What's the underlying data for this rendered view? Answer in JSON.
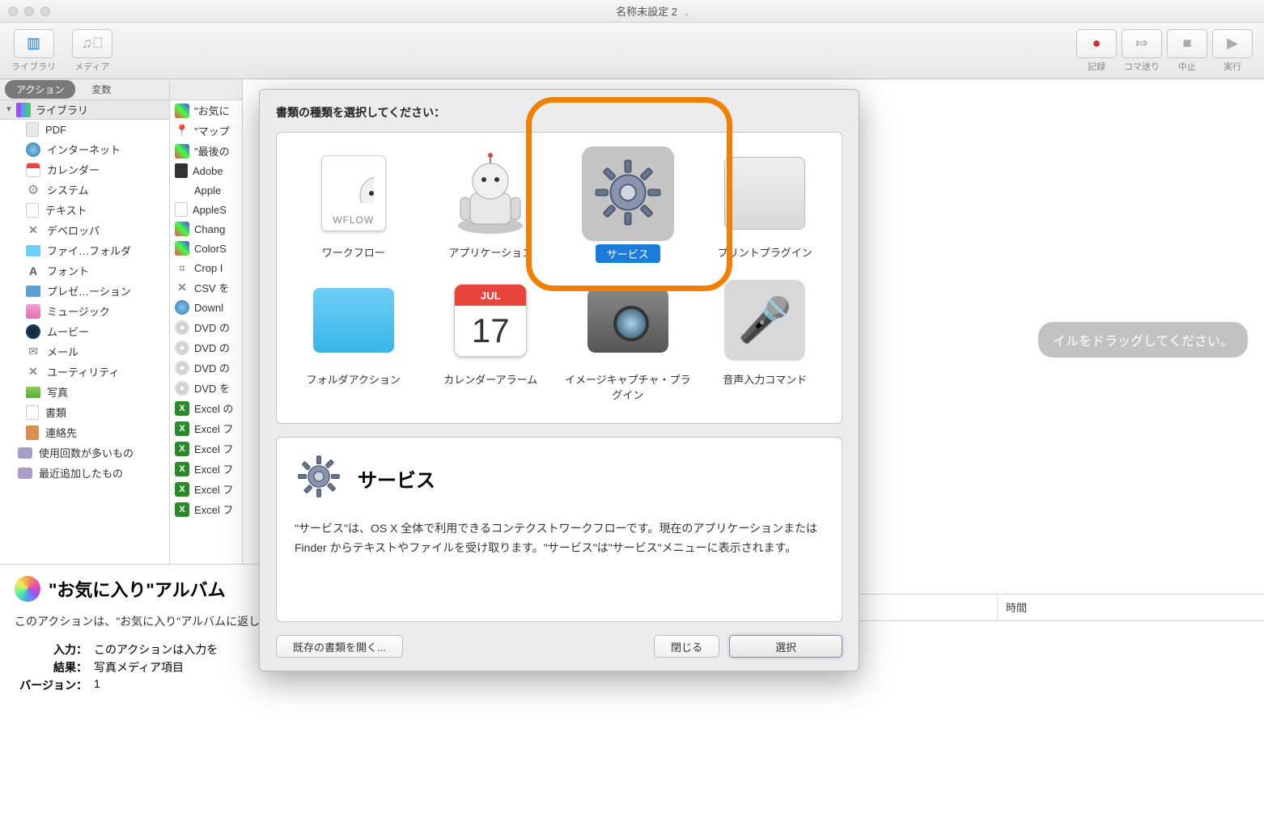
{
  "window": {
    "title": "名称未設定 2"
  },
  "toolbar": {
    "left": [
      {
        "label": "ライブラリ",
        "icon": "sidebar-icon",
        "active": true
      },
      {
        "label": "メディア",
        "icon": "media-icon"
      }
    ],
    "right": [
      {
        "label": "記録",
        "icon": "record-icon",
        "color": "#d03030"
      },
      {
        "label": "コマ送り",
        "icon": "step-icon"
      },
      {
        "label": "中止",
        "icon": "stop-icon"
      },
      {
        "label": "実行",
        "icon": "play-icon"
      }
    ]
  },
  "sidebarTabs": {
    "action": "アクション",
    "variable": "変数"
  },
  "libraryHeader": "ライブラリ",
  "libraryItems": [
    {
      "label": "PDF",
      "icon": "i-pdf"
    },
    {
      "label": "インターネット",
      "icon": "i-globe"
    },
    {
      "label": "カレンダー",
      "icon": "i-cal"
    },
    {
      "label": "システム",
      "icon": "i-gear"
    },
    {
      "label": "テキスト",
      "icon": "i-text"
    },
    {
      "label": "デベロッパ",
      "icon": "i-x"
    },
    {
      "label": "ファイ…フォルダ",
      "icon": "i-folder"
    },
    {
      "label": "フォント",
      "icon": "i-font"
    },
    {
      "label": "プレゼ…ーション",
      "icon": "i-keynote"
    },
    {
      "label": "ミュージック",
      "icon": "i-note"
    },
    {
      "label": "ムービー",
      "icon": "i-qt"
    },
    {
      "label": "メール",
      "icon": "i-mail"
    },
    {
      "label": "ユーティリティ",
      "icon": "i-x"
    },
    {
      "label": "写真",
      "icon": "i-photo"
    },
    {
      "label": "書類",
      "icon": "i-doc"
    },
    {
      "label": "連絡先",
      "icon": "i-book"
    }
  ],
  "smartFolders": [
    {
      "label": "使用回数が多いもの",
      "icon": "i-cam"
    },
    {
      "label": "最近追加したもの",
      "icon": "i-cam"
    }
  ],
  "actionItems": [
    {
      "label": "\"お気に",
      "icon": "i-colors"
    },
    {
      "label": "\"マップ",
      "icon": "i-pin"
    },
    {
      "label": "\"最後の",
      "icon": "i-colors"
    },
    {
      "label": "Adobe",
      "icon": "i-adobe"
    },
    {
      "label": "Apple",
      "icon": "i-apple"
    },
    {
      "label": "AppleS",
      "icon": "i-script"
    },
    {
      "label": "Chang",
      "icon": "i-colors"
    },
    {
      "label": "ColorS",
      "icon": "i-colors"
    },
    {
      "label": "Crop I",
      "icon": "i-crop"
    },
    {
      "label": "CSV を",
      "icon": "i-x"
    },
    {
      "label": "Downl",
      "icon": "i-safari"
    },
    {
      "label": "DVD の",
      "icon": "i-dvd"
    },
    {
      "label": "DVD の",
      "icon": "i-dvd"
    },
    {
      "label": "DVD の",
      "icon": "i-dvd"
    },
    {
      "label": "DVD を",
      "icon": "i-dvd"
    },
    {
      "label": "Excel の",
      "icon": "i-excel"
    },
    {
      "label": "Excel フ",
      "icon": "i-excel"
    },
    {
      "label": "Excel フ",
      "icon": "i-excel"
    },
    {
      "label": "Excel フ",
      "icon": "i-excel"
    },
    {
      "label": "Excel フ",
      "icon": "i-excel"
    },
    {
      "label": "Excel フ",
      "icon": "i-excel"
    }
  ],
  "descPanel": {
    "title": "\"お気に入り\"アルバム",
    "body": "このアクションは、\"お気に入り\"アルバムに返します。",
    "inputLabel": "入力：",
    "inputValue": "このアクションは入力を",
    "resultLabel": "結果：",
    "resultValue": "写真メディア項目",
    "versionLabel": "バージョン：",
    "versionValue": "1"
  },
  "canvas": {
    "dragHint": "イルをドラッグしてください。",
    "timeColumn": "時間"
  },
  "dialog": {
    "prompt": "書類の種類を選択してください：",
    "types": [
      {
        "label": "ワークフロー",
        "icon": "wflow"
      },
      {
        "label": "アプリケーション",
        "icon": "robot"
      },
      {
        "label": "サービス",
        "icon": "gear",
        "selected": true
      },
      {
        "label": "プリントプラグイン",
        "icon": "printer"
      },
      {
        "label": "フォルダアクション",
        "icon": "folder"
      },
      {
        "label": "カレンダーアラーム",
        "icon": "calendar"
      },
      {
        "label": "イメージキャプチャ・プラグイン",
        "icon": "camera"
      },
      {
        "label": "音声入力コマンド",
        "icon": "mic"
      }
    ],
    "calendarMonth": "JUL",
    "calendarDay": "17",
    "wflowText": "WFLOW",
    "info": {
      "title": "サービス",
      "text": "\"サービス\"は、OS X 全体で利用できるコンテクストワークフローです。現在のアプリケーションまたは Finder からテキストやファイルを受け取ります。\"サービス\"は\"サービス\"メニューに表示されます。"
    },
    "buttons": {
      "openExisting": "既存の書類を開く...",
      "close": "閉じる",
      "choose": "選択"
    }
  }
}
